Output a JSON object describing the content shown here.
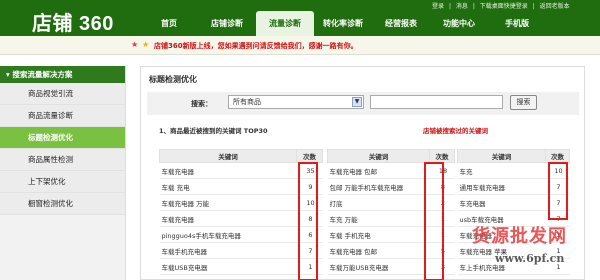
{
  "header": {
    "logo": "店铺 360",
    "top_links": [
      "登录",
      "|",
      "消息",
      "|",
      "下载桌面快捷登录",
      "|",
      "返回老版本"
    ],
    "nav": [
      {
        "label": "首页",
        "active": false
      },
      {
        "label": "店铺诊断",
        "active": false
      },
      {
        "label": "流量诊断",
        "active": true
      },
      {
        "label": "转化率诊断",
        "active": false
      },
      {
        "label": "经营报表",
        "active": false
      },
      {
        "label": "功能中心",
        "active": false
      },
      {
        "label": "手机版",
        "active": false
      }
    ]
  },
  "notice": "店铺360新版上线，您如果遇到问请反馈给我们，感谢一路有你。",
  "sidebar": {
    "heading": "搜索流量解决方案",
    "items": [
      {
        "label": "商品视觉引流",
        "active": false
      },
      {
        "label": "商品流量诊断",
        "active": false
      },
      {
        "label": "标题检测优化",
        "active": true
      },
      {
        "label": "商品属性检测",
        "active": false
      },
      {
        "label": "上下架优化",
        "active": false
      },
      {
        "label": "橱窗检测优化",
        "active": false
      }
    ]
  },
  "main": {
    "title": "标题检测优化",
    "search": {
      "label": "搜索：",
      "select_value": "所有商品",
      "input_value": "",
      "button": "搜索"
    },
    "section_title": "1、商品最近被搜到的关键词 TOP30",
    "section_note": "店铺被搜索过的关键词",
    "tables": [
      {
        "headers": [
          "关键词",
          "次数"
        ],
        "rows": [
          [
            "车载充电器",
            "35"
          ],
          [
            "车载 充电",
            "9"
          ],
          [
            "车载充电器 万能",
            "10"
          ],
          [
            "车载充电器",
            "8"
          ],
          [
            "pingguo4s手机车载充电器",
            "6"
          ],
          [
            "车载手机充电器",
            "7"
          ],
          [
            "车载USB充电器",
            "1"
          ]
        ]
      },
      {
        "headers": [
          "关键词",
          "次数"
        ],
        "rows": [
          [
            "车载充电器 包邮",
            "18"
          ],
          [
            "包邮 万能手机车载充电器",
            "8"
          ],
          [
            "打底",
            "2"
          ],
          [
            "车充 万能",
            "1"
          ],
          [
            "车载 手机充电",
            "1"
          ],
          [
            "车载充电器 包邮",
            "5"
          ],
          [
            "车载万能USB充电器",
            "3"
          ]
        ]
      },
      {
        "headers": [
          "关键词",
          "次数"
        ],
        "rows": [
          [
            "车充",
            "10"
          ],
          [
            "通用车载充电器",
            "7"
          ],
          [
            "车充电器",
            "7"
          ],
          [
            "usb车载充电器",
            "7"
          ],
          [
            "车载充电器",
            "1"
          ],
          [
            "车载充电器 苹果",
            "1"
          ],
          [
            "车上手机充电器",
            "1"
          ]
        ]
      }
    ]
  },
  "watermark": "货源批发网",
  "watermark_url": "www.6pf.cn",
  "colors": {
    "brand": "#1f6d0f",
    "active_side": "#7ac142",
    "alert_red": "#cc1111"
  }
}
